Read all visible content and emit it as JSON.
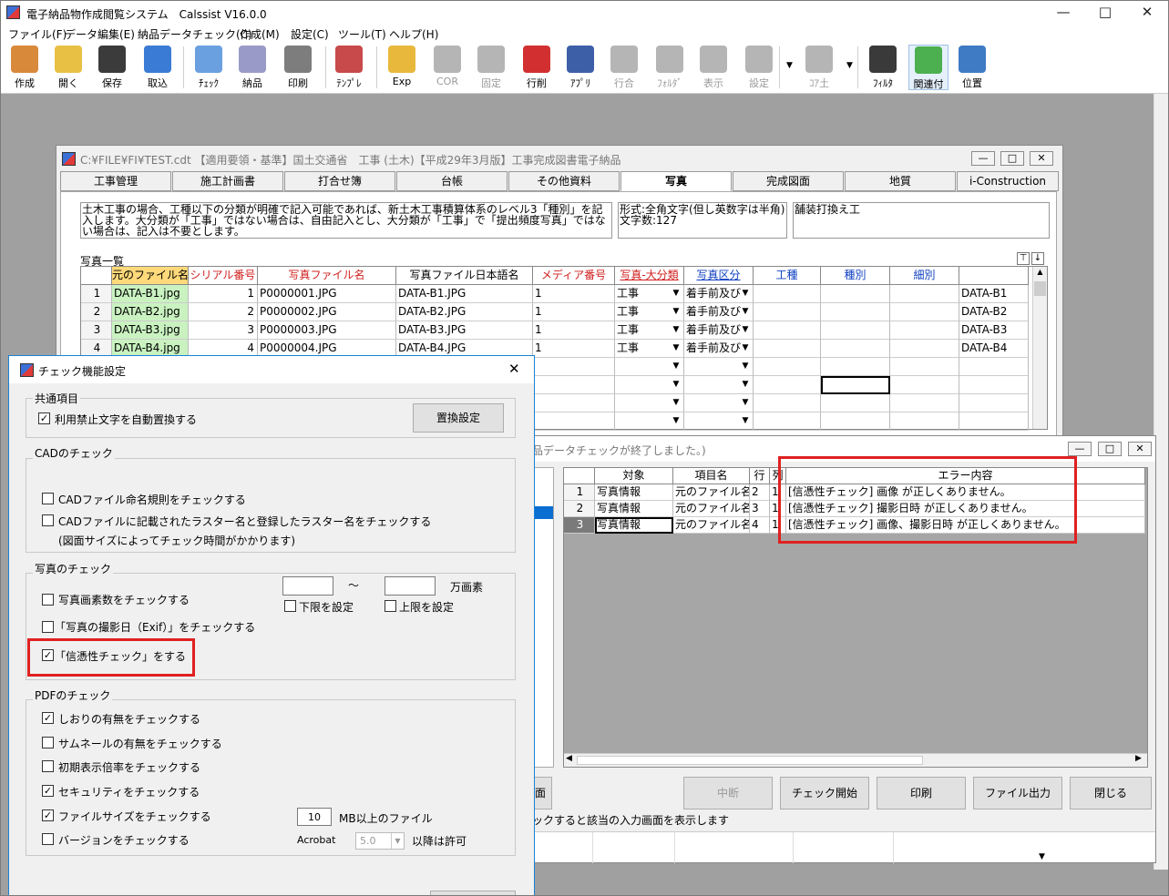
{
  "app": {
    "title": "電子納品物作成閲覧システム　Calssist V16.0.0",
    "window_controls": [
      "—",
      "□",
      "✕"
    ],
    "menus": [
      "ファイル(F)",
      "データ編集(E)",
      "納品データチェック(C)",
      "作成(M)",
      "設定(C)",
      "ツール(T)",
      "ヘルプ(H)"
    ]
  },
  "toolbar": [
    {
      "label": "作成",
      "icon": "create-icon",
      "enabled": true,
      "color": "#d9893a"
    },
    {
      "label": "開く",
      "icon": "open-folder-icon",
      "enabled": true,
      "color": "#e8c144"
    },
    {
      "label": "保存",
      "icon": "save-icon",
      "enabled": true,
      "color": "#3b3b3b"
    },
    {
      "label": "取込",
      "icon": "import-icon",
      "enabled": true,
      "color": "#3a7bd5"
    },
    {
      "label": "ﾁｪｯｸ",
      "icon": "check-magnifier-icon",
      "enabled": true,
      "color": "#6aa0e0"
    },
    {
      "label": "納品",
      "icon": "disc-icon",
      "enabled": true,
      "color": "#9a9ac8"
    },
    {
      "label": "印刷",
      "icon": "printer-icon",
      "enabled": true,
      "color": "#7d7d7d"
    },
    {
      "label": "ﾃﾝﾌﾟﾚ",
      "icon": "template-icon",
      "enabled": true,
      "color": "#c84a4a"
    },
    {
      "label": "Exp",
      "icon": "explorer-icon",
      "enabled": true,
      "color": "#e8b83c"
    },
    {
      "label": "COR",
      "icon": "cor-icon",
      "enabled": false,
      "color": "#b5b5b5"
    },
    {
      "label": "固定",
      "icon": "pin-icon",
      "enabled": false,
      "color": "#b5b5b5"
    },
    {
      "label": "行削",
      "icon": "delete-row-icon",
      "enabled": true,
      "color": "#d23030"
    },
    {
      "label": "ｱﾌﾟﾘ",
      "icon": "application-icon",
      "enabled": true,
      "color": "#3d5fa8"
    },
    {
      "label": "行合",
      "icon": "merge-row-icon",
      "enabled": false,
      "color": "#b5b5b5"
    },
    {
      "label": "ﾌｫﾙﾀﾞ",
      "icon": "folder-icon",
      "enabled": false,
      "color": "#b5b5b5"
    },
    {
      "label": "表示",
      "icon": "display-icon",
      "enabled": false,
      "color": "#b5b5b5"
    },
    {
      "label": "設定",
      "icon": "settings-icon",
      "enabled": false,
      "color": "#b5b5b5"
    },
    {
      "label": "ｺｱ土",
      "icon": "core-soil-icon",
      "enabled": false,
      "color": "#b5b5b5"
    },
    {
      "label": "ﾌｨﾙﾀ",
      "icon": "filter-icon",
      "enabled": true,
      "color": "#3a3a3a"
    },
    {
      "label": "関連付",
      "icon": "link-icon",
      "enabled": true,
      "color": "#4caf50"
    },
    {
      "label": "位置",
      "icon": "globe-icon",
      "enabled": true,
      "color": "#3e7bc4"
    }
  ],
  "docwin": {
    "title": "C:¥FILE¥FI¥TEST.cdt 【適用要領・基準】国土交通省　工事 (土木)【平成29年3月版】工事完成図書電子納品",
    "tabs": [
      "工事管理",
      "施工計画書",
      "打合せ簿",
      "台帳",
      "その他資料",
      "写真",
      "完成図面",
      "地質",
      "i-Construction"
    ],
    "selected_tab": "写真",
    "info_text": "土木工事の場合、工種以下の分類が明確で記入可能であれば、新土木工事積算体系のレベル3「種別」を記入します。大分類が「工事」ではない場合は、自由記入とし、大分類が「工事」で「提出頻度写真」ではない場合は、記入は不要とします。",
    "format_text": "形式:全角文字(但し英数字は半角)\n文字数:127",
    "value_text": "舗装打換え工",
    "list_title": "写真一覧",
    "columns": [
      "元のファイル名",
      "シリアル番号",
      "写真ファイル名",
      "写真ファイル日本語名",
      "メディア番号",
      "写真-大分類",
      "写真区分",
      "工種",
      "種別",
      "細別"
    ],
    "rows": [
      {
        "no": "1",
        "orig": "DATA-B1.jpg",
        "serial": "1",
        "file": "P0000001.JPG",
        "jname": "DATA-B1.JPG",
        "media": "1",
        "major": "工事",
        "kubun": "着手前及び",
        "extra": "DATA-B1"
      },
      {
        "no": "2",
        "orig": "DATA-B2.jpg",
        "serial": "2",
        "file": "P0000002.JPG",
        "jname": "DATA-B2.JPG",
        "media": "1",
        "major": "工事",
        "kubun": "着手前及び",
        "extra": "DATA-B2"
      },
      {
        "no": "3",
        "orig": "DATA-B3.jpg",
        "serial": "3",
        "file": "P0000003.JPG",
        "jname": "DATA-B3.JPG",
        "media": "1",
        "major": "工事",
        "kubun": "着手前及び",
        "extra": "DATA-B3"
      },
      {
        "no": "4",
        "orig": "DATA-B4.jpg",
        "serial": "4",
        "file": "P0000004.JPG",
        "jname": "DATA-B4.JPG",
        "media": "1",
        "major": "工事",
        "kubun": "着手前及び",
        "extra": "DATA-B4"
      }
    ]
  },
  "dialog": {
    "title": "チェック機能設定",
    "close": "✕",
    "common": {
      "label": "共通項目",
      "auto_replace": "利用禁止文字を自動置換する",
      "auto_replace_checked": true,
      "replace_button": "置換設定"
    },
    "cad": {
      "label": "CADのチェック",
      "naming": "CADファイル命名規則をチェックする",
      "naming_checked": false,
      "raster": "CADファイルに記載されたラスター名と登録したラスター名をチェックする",
      "raster_checked": false,
      "raster_note": "(図面サイズによってチェック時間がかかります)"
    },
    "photo": {
      "label": "写真のチェック",
      "pixels": "写真画素数をチェックする",
      "pixels_checked": false,
      "range_sep": "〜",
      "unit": "万画素",
      "lower": "下限を設定",
      "lower_checked": false,
      "upper": "上限を設定",
      "upper_checked": false,
      "exif": "「写真の撮影日（Exif）」をチェックする",
      "exif_checked": false,
      "trust": "「信憑性チェック」をする",
      "trust_checked": true
    },
    "pdf": {
      "label": "PDFのチェック",
      "bookmark": "しおりの有無をチェックする",
      "bookmark_checked": true,
      "thumbnail": "サムネールの有無をチェックする",
      "thumbnail_checked": false,
      "zoom": "初期表示倍率をチェックする",
      "zoom_checked": false,
      "security": "セキュリティをチェックする",
      "security_checked": true,
      "filesize": "ファイルサイズをチェックする",
      "filesize_checked": true,
      "filesize_value": "10",
      "filesize_unit": "MB以上のファイル",
      "version": "バージョンをチェックする",
      "version_checked": false,
      "acrobat": "Acrobat",
      "acrobat_value": "5.0",
      "acrobat_note": "以降は許可"
    }
  },
  "errwin": {
    "title": "品データチェックが終了しました。)",
    "columns": [
      "対象",
      "項目名",
      "行",
      "列",
      "エラー内容"
    ],
    "rows": [
      {
        "no": "1",
        "target": "写真情報",
        "item": "元のファイル名",
        "row": "2",
        "col": "1",
        "error": "[信憑性チェック] 画像 が正しくありません。"
      },
      {
        "no": "2",
        "target": "写真情報",
        "item": "元のファイル名",
        "row": "3",
        "col": "1",
        "error": "[信憑性チェック] 撮影日時 が正しくありません。"
      },
      {
        "no": "3",
        "target": "写真情報",
        "item": "元のファイル名",
        "row": "4",
        "col": "1",
        "error": "[信憑性チェック] 画像、撮影日時 が正しくありません。"
      }
    ],
    "buttons": [
      "中断",
      "チェック開始",
      "印刷",
      "ファイル出力",
      "閉じる"
    ],
    "hint": "ックすると該当の入力画面を表示します",
    "left_button": "面"
  }
}
